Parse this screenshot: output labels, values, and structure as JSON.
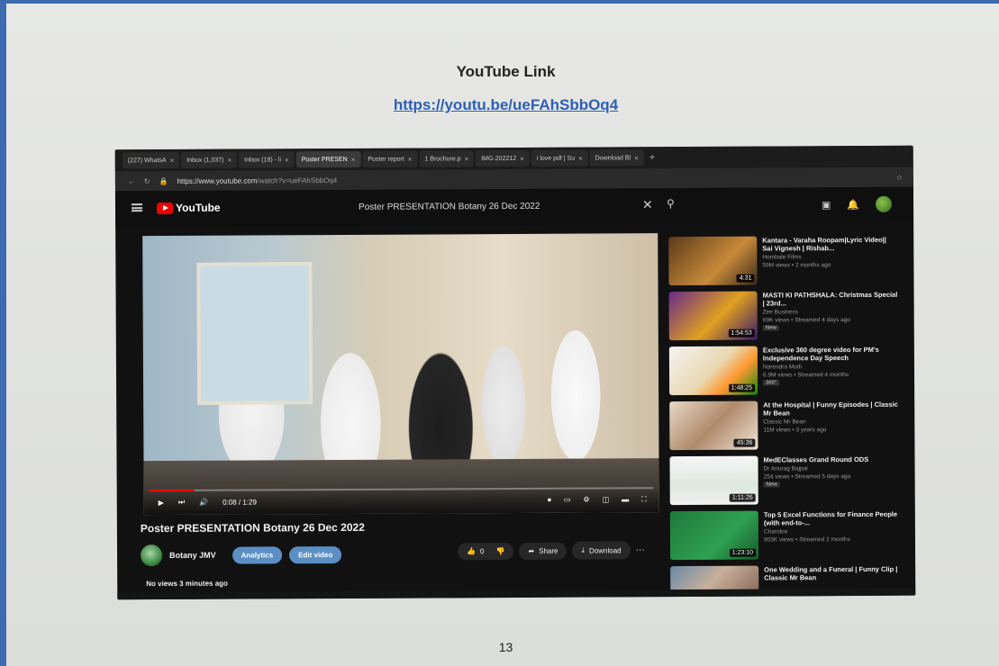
{
  "page": {
    "heading": "YouTube Link",
    "link": "https://youtu.be/ueFAhSbbOq4",
    "page_number": "13"
  },
  "browser": {
    "tabs": [
      {
        "label": "(227) WhatsA",
        "active": false
      },
      {
        "label": "Inbox (1,037)",
        "active": false
      },
      {
        "label": "Inbox (18) - li",
        "active": false
      },
      {
        "label": "Poster PRESEN",
        "active": true
      },
      {
        "label": "Poster report",
        "active": false
      },
      {
        "label": "1 Brochure.p",
        "active": false
      },
      {
        "label": "IMG-202212",
        "active": false
      },
      {
        "label": "i love pdf | Su",
        "active": false
      },
      {
        "label": "Download Bl",
        "active": false
      }
    ],
    "url_host": "https://www.youtube.com",
    "url_path": "/watch?v=ueFAhSbbOq4"
  },
  "youtube": {
    "logo": "YouTube",
    "header_title": "Poster PRESENTATION Botany 26 Dec 2022",
    "time": "0:08 / 1:29",
    "progress": 0.09,
    "video_title": "Poster PRESENTATION Botany 26 Dec 2022",
    "channel": "Botany JMV",
    "analytics_label": "Analytics",
    "edit_label": "Edit video",
    "likes": "0",
    "share_label": "Share",
    "download_label": "Download",
    "meta": "No views  3 minutes ago"
  },
  "related": [
    {
      "title": "Kantara - Varaha Roopam|Lyric Video|| Sai Vignesh | Rishab...",
      "channel": "Hombale Films",
      "views": "59M views • 2 months ago",
      "duration": "4:31",
      "badge": ""
    },
    {
      "title": "MASTI KI PATHSHALA: Christmas Special | 23rd...",
      "channel": "Zee Business",
      "views": "69K views • Streamed 4 days ago",
      "duration": "1:54:53",
      "badge": "New"
    },
    {
      "title": "Exclusive 360 degree video for PM's Independence Day Speech",
      "channel": "Narendra Modi",
      "views": "6.9M views • Streamed 4 months",
      "duration": "1:48:25",
      "badge": "360°"
    },
    {
      "title": "At the Hospital | Funny Episodes | Classic Mr Bean",
      "channel": "Classic Mr Bean",
      "views": "11M views • 3 years ago",
      "duration": "45:36",
      "badge": ""
    },
    {
      "title": "MedEClasses Grand Round ODS",
      "channel": "Dr Anurag Bajpai",
      "views": "254 views • Streamed 5 days ago",
      "duration": "1:11:26",
      "badge": "New"
    },
    {
      "title": "Top 5 Excel Functions for Finance People (with end-to-...",
      "channel": "Chandoo",
      "views": "903K views • Streamed 2 months",
      "duration": "1:23:10",
      "badge": ""
    },
    {
      "title": "One Wedding and a Funeral | Funny Clip | Classic Mr Bean",
      "channel": "",
      "views": "",
      "duration": "",
      "badge": ""
    }
  ],
  "colors": {
    "link_blue": "#2d5fb5",
    "youtube_red": "#ff0000",
    "pill_blue": "#5b8fc4",
    "page_border": "#3d6bb0"
  }
}
